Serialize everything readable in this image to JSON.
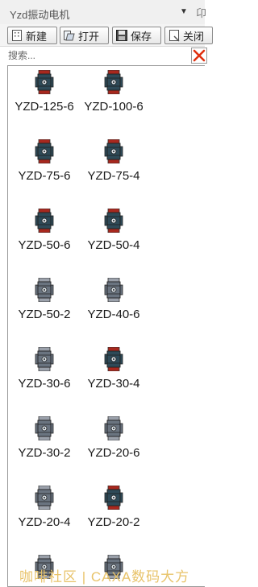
{
  "window": {
    "title": "Yzd振动电机"
  },
  "toolbar": {
    "new_label": "新建",
    "open_label": "打开",
    "save_label": "保存",
    "close_label": "关闭"
  },
  "search": {
    "placeholder": "搜索...",
    "value": ""
  },
  "items": [
    {
      "label": "YZD-125-6",
      "style": "red"
    },
    {
      "label": "YZD-100-6",
      "style": "red"
    },
    {
      "label": "YZD-75-6",
      "style": "red"
    },
    {
      "label": "YZD-75-4",
      "style": "red"
    },
    {
      "label": "YZD-50-6",
      "style": "red"
    },
    {
      "label": "YZD-50-4",
      "style": "red"
    },
    {
      "label": "YZD-50-2",
      "style": "gray"
    },
    {
      "label": "YZD-40-6",
      "style": "gray"
    },
    {
      "label": "YZD-30-6",
      "style": "gray"
    },
    {
      "label": "YZD-30-4",
      "style": "red"
    },
    {
      "label": "YZD-30-2",
      "style": "gray"
    },
    {
      "label": "YZD-20-6",
      "style": "gray"
    },
    {
      "label": "YZD-20-4",
      "style": "gray"
    },
    {
      "label": "YZD-20-2",
      "style": "red"
    },
    {
      "label": "",
      "style": "gray"
    },
    {
      "label": "",
      "style": "gray"
    }
  ],
  "colors": {
    "red_flange": "#a8281e",
    "gray_flange": "#9aa0aa",
    "body_dark": "#2e4a58",
    "body_gray": "#6a7480",
    "watermark": "#e8c36a"
  },
  "watermark": "咖啡社区 | CAXA数码大方"
}
